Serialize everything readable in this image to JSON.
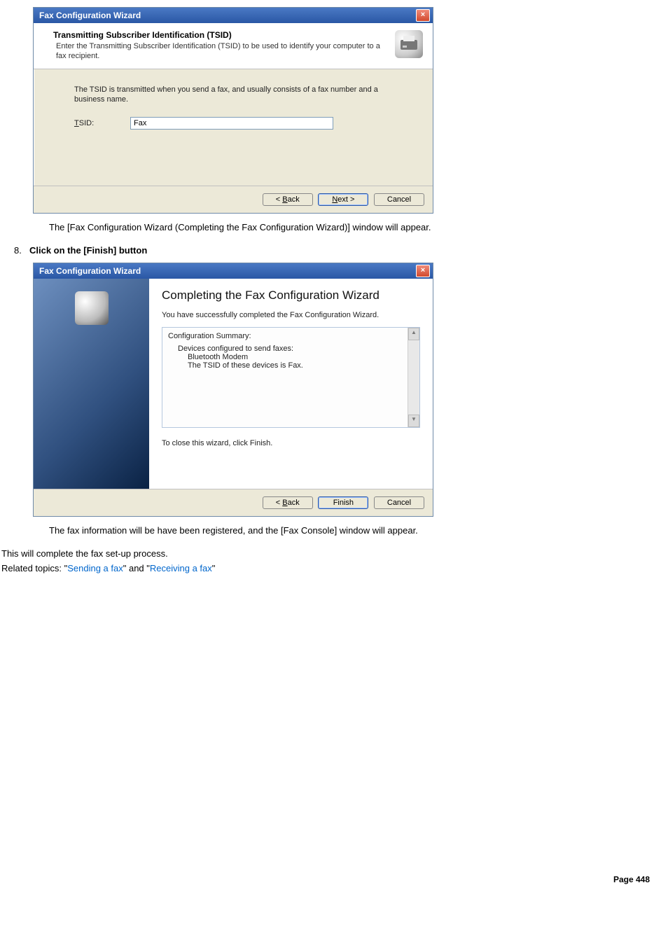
{
  "wizard1": {
    "title": "Fax Configuration Wizard",
    "close_glyph": "×",
    "header_title": "Transmitting Subscriber Identification (TSID)",
    "header_desc": "Enter the Transmitting Subscriber Identification (TSID) to be used to identify your computer to a fax recipient.",
    "body_desc": "The TSID is transmitted when you send a fax, and usually consists of a fax number and a business name.",
    "tsid_label_pre": "T",
    "tsid_label_post": "SID:",
    "tsid_value": "Fax",
    "btn_back_pre": "< ",
    "btn_back_u": "B",
    "btn_back_post": "ack",
    "btn_next_u": "N",
    "btn_next_post": "ext >",
    "btn_cancel": "Cancel"
  },
  "doc": {
    "after_w1": "The [Fax Configuration Wizard (Completing the Fax Configuration Wizard)] window will appear.",
    "step_num": "8.",
    "step_text": "Click on the [Finish] button",
    "after_w2": "The fax information will be have been registered, and the [Fax Console] window will appear.",
    "closing": "This will complete the fax set-up process.",
    "related_prefix": "Related topics: \"",
    "related_link1": "Sending a fax",
    "related_mid": "\" and \"",
    "related_link2": "Receiving a fax",
    "related_suffix": "\"",
    "page_footer": "Page 448"
  },
  "wizard2": {
    "title": "Fax Configuration Wizard",
    "close_glyph": "×",
    "big_title": "Completing the Fax Configuration Wizard",
    "sub": "You have successfully completed the Fax Configuration Wizard.",
    "summary_title": "Configuration Summary:",
    "sum_line1": "Devices configured to send faxes:",
    "sum_line2": "Bluetooth Modem",
    "sum_line3": "The TSID of these devices is Fax.",
    "close_instr": "To close this wizard, click Finish.",
    "btn_back_pre": "< ",
    "btn_back_u": "B",
    "btn_back_post": "ack",
    "btn_finish": "Finish",
    "btn_cancel": "Cancel"
  }
}
